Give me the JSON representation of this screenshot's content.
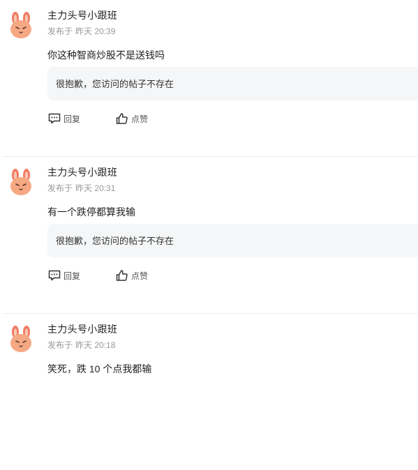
{
  "colors": {
    "avatar_ear": "#f07a62",
    "avatar_face": "#f6a883",
    "meta_text": "#999999",
    "quote_bg": "#f5f6f7"
  },
  "icons": {
    "avatar": "bunny-avatar-icon",
    "reply": "comment-icon",
    "like": "thumbs-up-icon"
  },
  "posts": [
    {
      "author": "主力头号小跟班",
      "meta_prefix": "发布于",
      "time": "昨天 20:39",
      "content": "你这种智商炒股不是送钱吗",
      "quote": "很抱歉，您访问的帖子不存在",
      "reply_label": "回复",
      "like_label": "点赞"
    },
    {
      "author": "主力头号小跟班",
      "meta_prefix": "发布于",
      "time": "昨天 20:31",
      "content": "有一个跌停都算我输",
      "quote": "很抱歉，您访问的帖子不存在",
      "reply_label": "回复",
      "like_label": "点赞"
    },
    {
      "author": "主力头号小跟班",
      "meta_prefix": "发布于",
      "time": "昨天 20:18",
      "content": "笑死，跌 10 个点我都输",
      "quote": "",
      "reply_label": "",
      "like_label": ""
    }
  ]
}
